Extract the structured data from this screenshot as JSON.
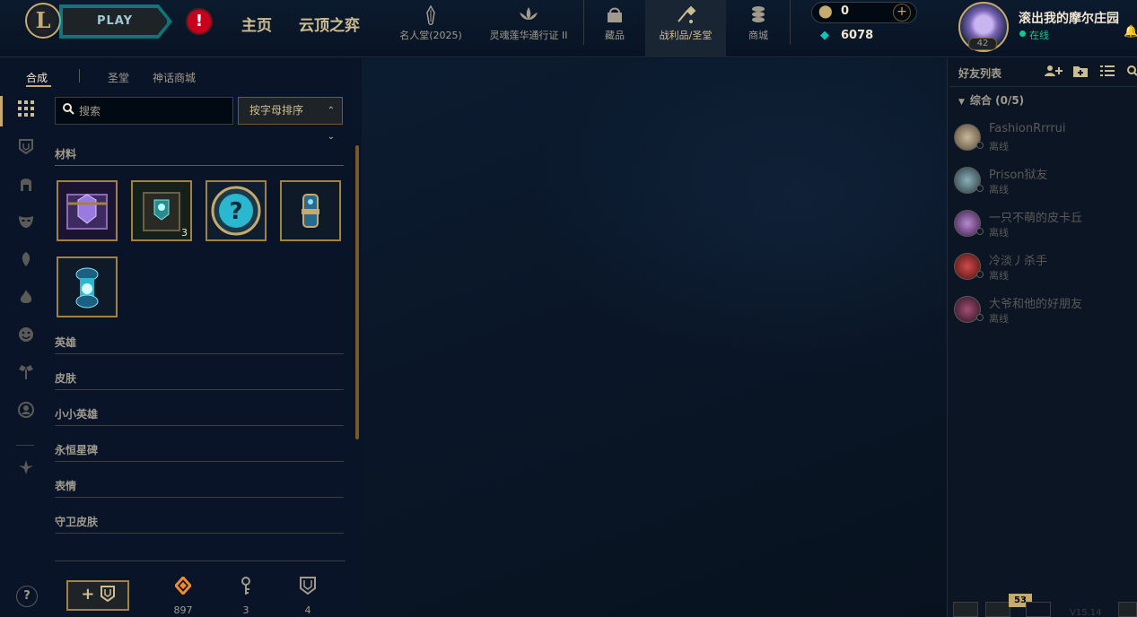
{
  "topnav": {
    "logo": "L",
    "play_label": "PLAY",
    "alert": "!",
    "main_tabs": [
      "主页",
      "云顶之弈"
    ],
    "icon_tabs": [
      {
        "label": "名人堂(2025)",
        "icon": "hall-of-legends-icon"
      },
      {
        "label": "灵魂莲华通行证 II",
        "icon": "lotus-pass-icon"
      },
      {
        "label": "藏品",
        "icon": "collection-icon"
      },
      {
        "label": "战利品/圣堂",
        "icon": "loot-icon"
      },
      {
        "label": "商城",
        "icon": "store-icon"
      }
    ],
    "rp_value": "0",
    "be_value": "6078",
    "summoner_name": "滚出我的摩尔庄园",
    "level": "42",
    "status": "在线"
  },
  "loot": {
    "subtabs": [
      "合成",
      "圣堂",
      "神话商城"
    ],
    "search_placeholder": "搜索",
    "sort_label": "按字母排序",
    "sections": [
      "材料",
      "英雄",
      "皮肤",
      "小小英雄",
      "永恒星碑",
      "表情",
      "守卫皮肤"
    ],
    "materials": [
      {
        "name": "hextech-chest",
        "count": ""
      },
      {
        "name": "masterwork-chest",
        "count": "3"
      },
      {
        "name": "mystery-orb",
        "count": ""
      },
      {
        "name": "loot-capsule",
        "count": ""
      },
      {
        "name": "glowing-capsule",
        "count": ""
      }
    ],
    "resources": [
      {
        "icon": "orange-essence-icon",
        "value": "897",
        "color": "#f08a2a"
      },
      {
        "icon": "key-fragment-icon",
        "value": "3",
        "color": "#a09b8c"
      },
      {
        "icon": "ward-icon",
        "value": "4",
        "color": "#a09b8c"
      }
    ],
    "help": "?"
  },
  "friends": {
    "title": "好友列表",
    "group": "综合 (0/5)",
    "list": [
      {
        "name": "FashionRrrrui",
        "status": "离线",
        "color": "#8a7a5a"
      },
      {
        "name": "Prison狱友",
        "status": "离线",
        "color": "#3a5a6a"
      },
      {
        "name": "一只不萌的皮卡丘",
        "status": "离线",
        "color": "#6a3a7a"
      },
      {
        "name": "冷淡丿杀手",
        "status": "离线",
        "color": "#7a2a2a"
      },
      {
        "name": "大爷和他的好朋友",
        "status": "离线",
        "color": "#5a2a3a"
      }
    ],
    "footer_badge": "53",
    "version": "V15.14"
  },
  "colors": {
    "gold": "#c8aa6e",
    "teal": "#0ac8b9",
    "online": "#0acb8c"
  }
}
